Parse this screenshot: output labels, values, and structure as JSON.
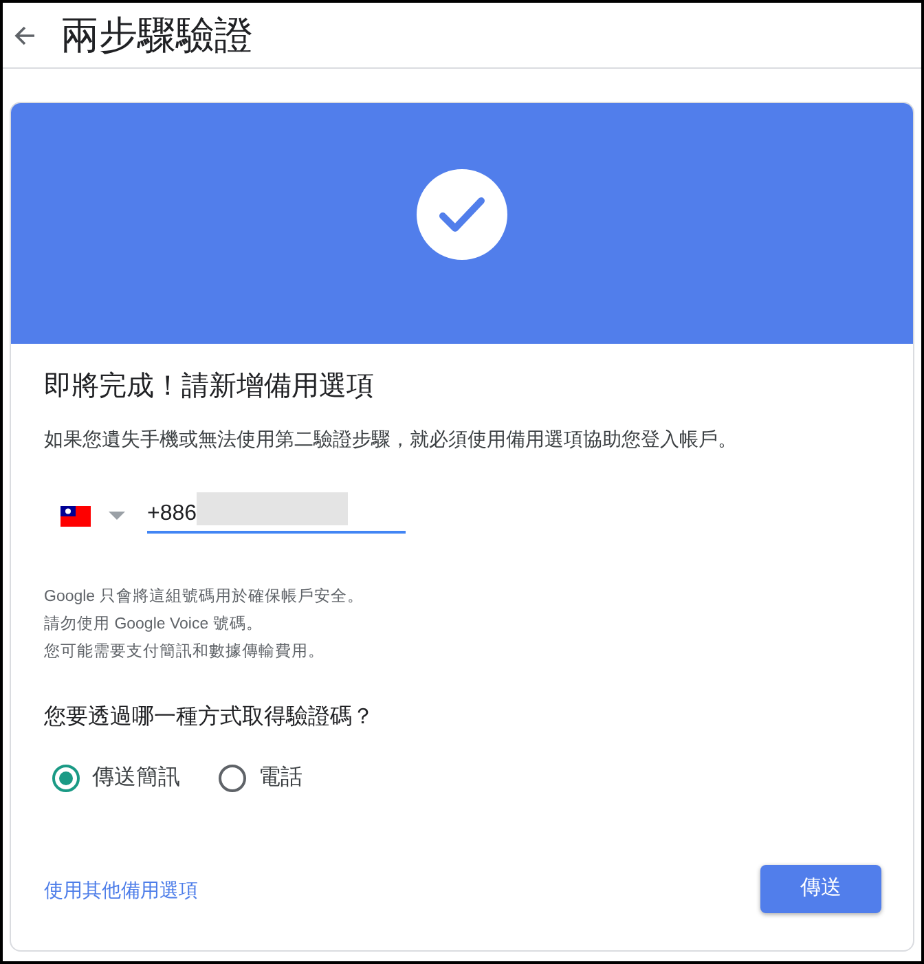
{
  "header": {
    "title": "兩步驟驗證"
  },
  "card": {
    "heading": "即將完成！請新增備用選項",
    "description": "如果您遺失手機或無法使用第二驗證步驟，就必須使用備用選項協助您登入帳戶。",
    "phone_field": {
      "value": "+886"
    },
    "notes": [
      "Google 只會將這組號碼用於確保帳戶安全。",
      "請勿使用 Google Voice 號碼。",
      "您可能需要支付簡訊和數據傳輸費用。"
    ],
    "question": "您要透過哪一種方式取得驗證碼？",
    "options": [
      {
        "label": "傳送簡訊",
        "selected": true
      },
      {
        "label": "電話",
        "selected": false
      }
    ],
    "link": "使用其他備用選項",
    "button": "傳送"
  }
}
